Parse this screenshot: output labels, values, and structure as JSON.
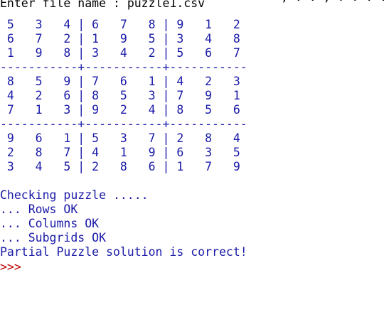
{
  "window": {
    "top_clipped_text": ", . . , . . . . ."
  },
  "console": {
    "input_prompt": "Enter file name : ",
    "input_value": "puzzle1.csv",
    "grid_lines": [
      " 5   3   4 | 6   7   8 | 9   1   2",
      " 6   7   2 | 1   9   5 | 3   4   8",
      " 1   9   8 | 3   4   2 | 5   6   7",
      "-----------+-----------+-----------",
      " 8   5   9 | 7   6   1 | 4   2   3",
      " 4   2   6 | 8   5   3 | 7   9   1",
      " 7   1   3 | 9   2   4 | 8   5   6",
      "-----------+-----------+-----------",
      " 9   6   1 | 5   3   7 | 2   8   4",
      " 2   8   7 | 4   1   9 | 6   3   5",
      " 3   4   5 | 2   8   6 | 1   7   9"
    ],
    "checking": "Checking puzzle .....",
    "rows_ok": "... Rows OK",
    "columns_ok": "... Columns OK",
    "subgrids_ok": "... Subgrids OK",
    "result": "Partial Puzzle solution is correct!",
    "shell_prompt": ">>>"
  },
  "colors": {
    "output": "#1a1aa8",
    "input": "#000000",
    "prompt": "#c00000",
    "background": "#ffffff"
  }
}
